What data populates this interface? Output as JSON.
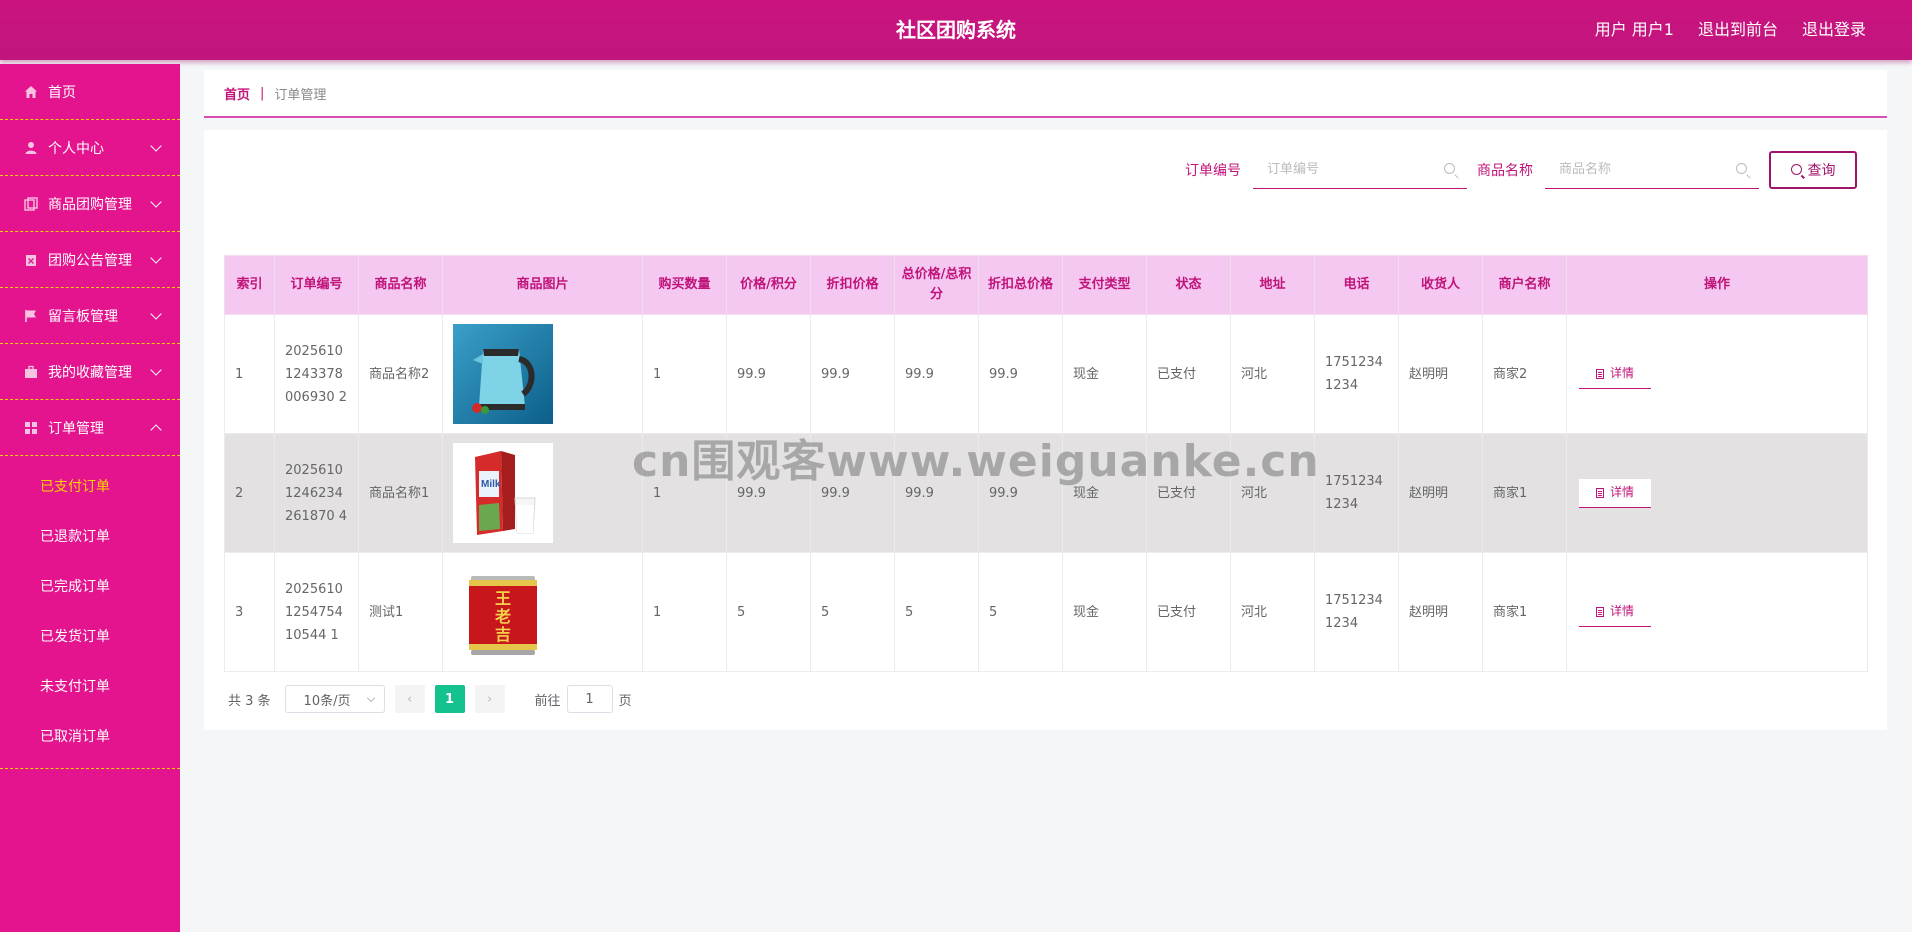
{
  "header": {
    "title": "社区团购系统",
    "user_label": "用户 用户1",
    "front_link": "退出到前台",
    "logout": "退出登录"
  },
  "sidebar": {
    "items": [
      {
        "label": "首页",
        "icon": "home-icon"
      },
      {
        "label": "个人中心",
        "icon": "user-icon"
      },
      {
        "label": "商品团购管理",
        "icon": "copy-icon"
      },
      {
        "label": "团购公告管理",
        "icon": "clipboard-icon"
      },
      {
        "label": "留言板管理",
        "icon": "flag-icon"
      },
      {
        "label": "我的收藏管理",
        "icon": "briefcase-icon"
      },
      {
        "label": "订单管理",
        "icon": "grid-icon"
      }
    ],
    "submenu": [
      "已支付订单",
      "已退款订单",
      "已完成订单",
      "已发货订单",
      "未支付订单",
      "已取消订单"
    ],
    "active_sub": "已支付订单"
  },
  "breadcrumb": {
    "home": "首页",
    "current": "订单管理"
  },
  "search": {
    "order_label": "订单编号",
    "order_placeholder": "订单编号",
    "goods_label": "商品名称",
    "goods_placeholder": "商品名称",
    "query_button": "查询"
  },
  "table": {
    "headers": [
      "索引",
      "订单编号",
      "商品名称",
      "商品图片",
      "购买数量",
      "价格/积分",
      "折扣价格",
      "总价格/总积分",
      "折扣总价格",
      "支付类型",
      "状态",
      "地址",
      "电话",
      "收货人",
      "商户名称",
      "操作"
    ],
    "rows": [
      {
        "index": "1",
        "order_no": "20256101243378006930 2",
        "goods": "商品名称2",
        "image": "kettle",
        "qty": "1",
        "price": "99.9",
        "discount": "99.9",
        "total": "99.9",
        "discount_total": "99.9",
        "pay": "现金",
        "status": "已支付",
        "addr": "河北",
        "phone": "17512341234",
        "receiver": "赵明明",
        "merchant": "商家2",
        "action": "详情"
      },
      {
        "index": "2",
        "order_no": "20256101246234261870 4",
        "goods": "商品名称1",
        "image": "milk",
        "qty": "1",
        "price": "99.9",
        "discount": "99.9",
        "total": "99.9",
        "discount_total": "99.9",
        "pay": "现金",
        "status": "已支付",
        "addr": "河北",
        "phone": "17512341234",
        "receiver": "赵明明",
        "merchant": "商家1",
        "action": "详情"
      },
      {
        "index": "3",
        "order_no": "2025610125475410544 1",
        "goods": "测试1",
        "image": "can",
        "qty": "1",
        "price": "5",
        "discount": "5",
        "total": "5",
        "discount_total": "5",
        "pay": "现金",
        "status": "已支付",
        "addr": "河北",
        "phone": "17512341234",
        "receiver": "赵明明",
        "merchant": "商家1",
        "action": "详情"
      }
    ]
  },
  "pagination": {
    "total": "共 3 条",
    "page_size": "10条/页",
    "current": "1",
    "goto_prefix": "前往",
    "goto_value": "1",
    "goto_suffix": "页"
  },
  "watermark": "cn围观客www.weiguanke.cn",
  "colors": {
    "accent": "#c0147a",
    "sidebar": "#e3148e",
    "header_bg": "#f4c8f1",
    "active_page": "#13c28e"
  }
}
